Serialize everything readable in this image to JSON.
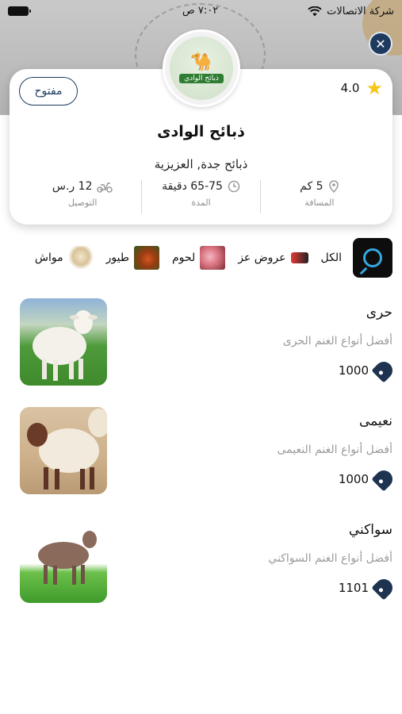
{
  "status_bar": {
    "carrier": "شركة الاتصالات",
    "time": "٧:٠٢ ص"
  },
  "header": {
    "close_icon": "close-icon"
  },
  "store": {
    "open_label": "مفتوح",
    "rating": "4.0",
    "name": "ذبائح الوادى",
    "subtitle": "ذبائح جدة, العزيزية",
    "logo_text": "ذبائح الوادي",
    "info": [
      {
        "icon": "location-pin-icon",
        "value": "5 كم",
        "label": "المسافة"
      },
      {
        "icon": "clock-icon",
        "value": "65-75 دقيقة",
        "label": "المدة"
      },
      {
        "icon": "scooter-icon",
        "value": "12 ر.س",
        "label": "التوصيل"
      }
    ]
  },
  "categories": [
    {
      "label": "الكل"
    },
    {
      "label": "عروض عز"
    },
    {
      "label": "لحوم"
    },
    {
      "label": "طيور"
    },
    {
      "label": "مواش"
    }
  ],
  "products": [
    {
      "name": "حرى",
      "description": "أفضل أنواع الغنم الحرى",
      "price": "1000"
    },
    {
      "name": "نعيمى",
      "description": "أفضل أنواع الغنم النعيمى",
      "price": "1000"
    },
    {
      "name": "سواكني",
      "description": "أفضل أنواع الغنم السواكني",
      "price": "1101"
    }
  ],
  "colors": {
    "accent": "#1e3a5f",
    "star": "#f6c619",
    "search_tile": "#0d0d0d",
    "search_lens": "#35a8e0"
  }
}
